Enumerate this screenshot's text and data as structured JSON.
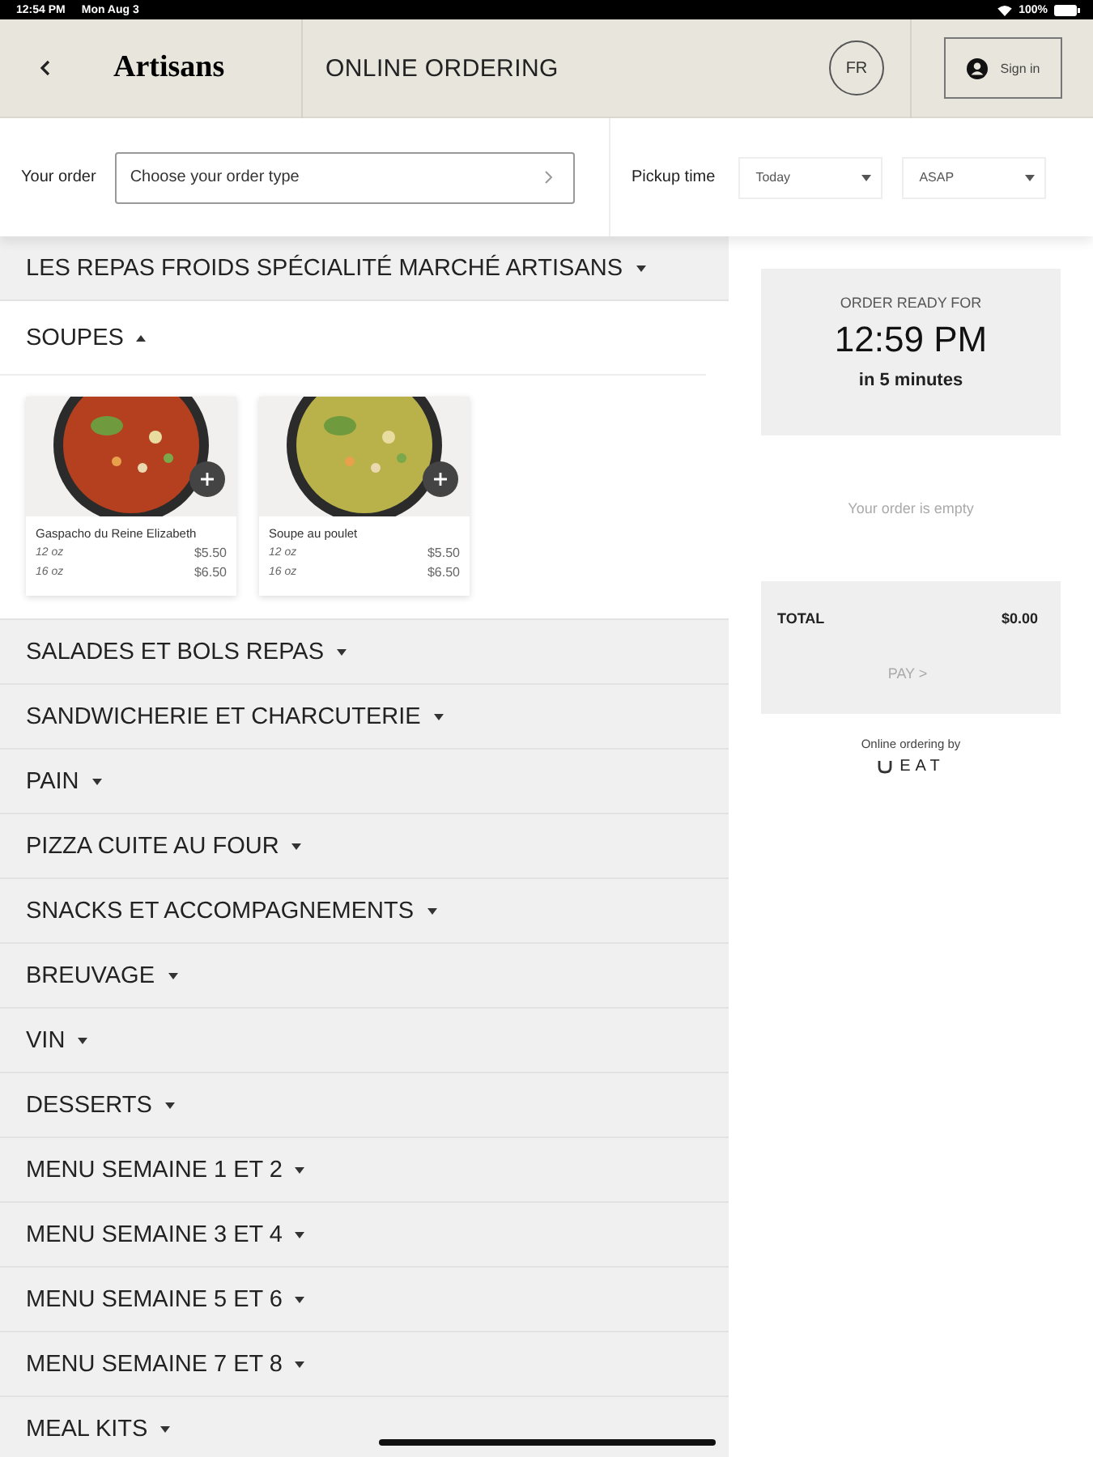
{
  "status_bar": {
    "time": "12:54 PM",
    "date": "Mon Aug 3",
    "battery": "100%"
  },
  "header": {
    "logo": "Artisans",
    "title": "ONLINE ORDERING",
    "language": "FR",
    "sign_in": "Sign in"
  },
  "order_bar": {
    "label": "Your order",
    "order_type": {
      "placeholder": "Choose your order type"
    },
    "pickup_label": "Pickup time",
    "day": "Today",
    "time": "ASAP"
  },
  "categories": [
    {
      "name": "LES REPAS FROIDS SPÉCIALITÉ MARCHÉ ARTISANS",
      "expanded": false
    },
    {
      "name": "SOUPES",
      "expanded": true,
      "products": [
        {
          "name": "Gaspacho du Reine Elizabeth",
          "kind": "picture",
          "sizes": [
            {
              "size": "12 oz",
              "price": "$5.50"
            },
            {
              "size": "16 oz",
              "price": "$6.50"
            }
          ]
        },
        {
          "name": "Soupe au poulet",
          "kind": "picture",
          "sizes": [
            {
              "size": "12 oz",
              "price": "$5.50"
            },
            {
              "size": "16 oz",
              "price": "$6.50"
            }
          ]
        }
      ]
    },
    {
      "name": "SALADES ET BOLS REPAS",
      "expanded": false
    },
    {
      "name": "SANDWICHERIE ET CHARCUTERIE",
      "expanded": false
    },
    {
      "name": "PAIN",
      "expanded": false
    },
    {
      "name": "PIZZA CUITE AU FOUR",
      "expanded": false
    },
    {
      "name": "SNACKS ET ACCOMPAGNEMENTS",
      "expanded": false
    },
    {
      "name": "BREUVAGE",
      "expanded": false
    },
    {
      "name": "VIN",
      "expanded": false
    },
    {
      "name": "DESSERTS",
      "expanded": false
    },
    {
      "name": "MENU SEMAINE 1 ET 2",
      "expanded": false
    },
    {
      "name": "MENU SEMAINE 3 ET 4",
      "expanded": false
    },
    {
      "name": "MENU SEMAINE 5 ET 6",
      "expanded": false
    },
    {
      "name": "MENU SEMAINE 7 ET 8",
      "expanded": false
    },
    {
      "name": "MEAL KITS",
      "expanded": false
    }
  ],
  "summary": {
    "ready_label": "ORDER READY FOR",
    "ready_time": "12:59 PM",
    "ready_in": "in 5 minutes",
    "empty_text": "Your order is empty",
    "total_label": "TOTAL",
    "total": "$0.00",
    "pay": "PAY >",
    "powered_by": "Online ordering by",
    "brand": "EAT"
  }
}
